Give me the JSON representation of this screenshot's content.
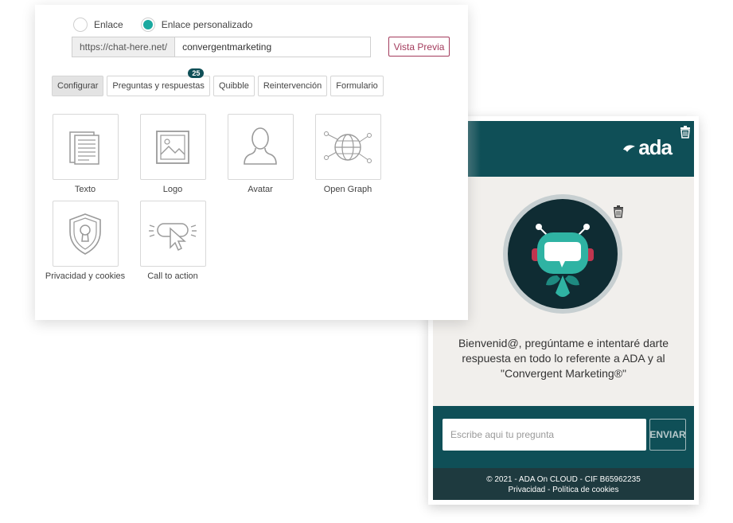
{
  "editor": {
    "link_options": [
      {
        "label": "Enlace",
        "selected": false
      },
      {
        "label": "Enlace personalizado",
        "selected": true
      }
    ],
    "url_prefix": "https://chat-here.net/",
    "url_value": "convergentmarketing",
    "preview_button": "Vista Previa",
    "tabs": [
      {
        "label": "Configurar",
        "active": true
      },
      {
        "label": "Preguntas y respuestas",
        "badge": "25"
      },
      {
        "label": "Quibble"
      },
      {
        "label": "Reintervención"
      },
      {
        "label": "Formulario"
      }
    ],
    "tiles": [
      {
        "label": "Texto",
        "icon": "document-icon"
      },
      {
        "label": "Logo",
        "icon": "image-icon"
      },
      {
        "label": "Avatar",
        "icon": "avatar-icon"
      },
      {
        "label": "Open Graph",
        "icon": "globe-network-icon"
      },
      {
        "label": "Privacidad y cookies",
        "icon": "shield-lock-icon"
      },
      {
        "label": "Call to action",
        "icon": "cursor-click-icon"
      }
    ]
  },
  "preview": {
    "logo_text": "ada",
    "welcome": "Bienvenid@, pregúntame e intentaré darte respuesta en todo lo referente a ADA y al \"Convergent Marketing®\"",
    "input_placeholder": "Escribe aqui tu pregunta",
    "send_button": "ENVIAR",
    "footer_line1": "© 2021 - ADA On CLOUD - CIF B65962235",
    "footer_line2": "Privacidad - Política de cookies",
    "colors": {
      "header": "#0f4f57",
      "footer": "#1e3a3f",
      "accent": "#1aa9a0",
      "preview_button": "#a33b5c"
    }
  }
}
